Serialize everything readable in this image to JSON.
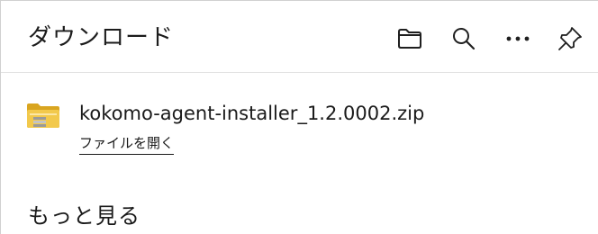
{
  "header": {
    "title": "ダウンロード",
    "buttons": [
      {
        "name": "open-downloads-folder",
        "icon": "folder-icon"
      },
      {
        "name": "search-downloads",
        "icon": "search-icon"
      },
      {
        "name": "more-options",
        "icon": "more-horizontal-icon"
      },
      {
        "name": "pin-downloads",
        "icon": "pin-icon"
      }
    ]
  },
  "downloads": [
    {
      "file_name": "kokomo-agent-installer_1.2.0002.zip",
      "action_label": "ファイルを開く",
      "icon": "zip-folder-icon"
    }
  ],
  "footer": {
    "see_more_label": "もっと見る"
  },
  "colors": {
    "background": "#ffffff",
    "text": "#1a1a1a",
    "divider": "#e1e1e1",
    "folder_yellow": "#f2c94c",
    "folder_dark": "#d9a520"
  }
}
